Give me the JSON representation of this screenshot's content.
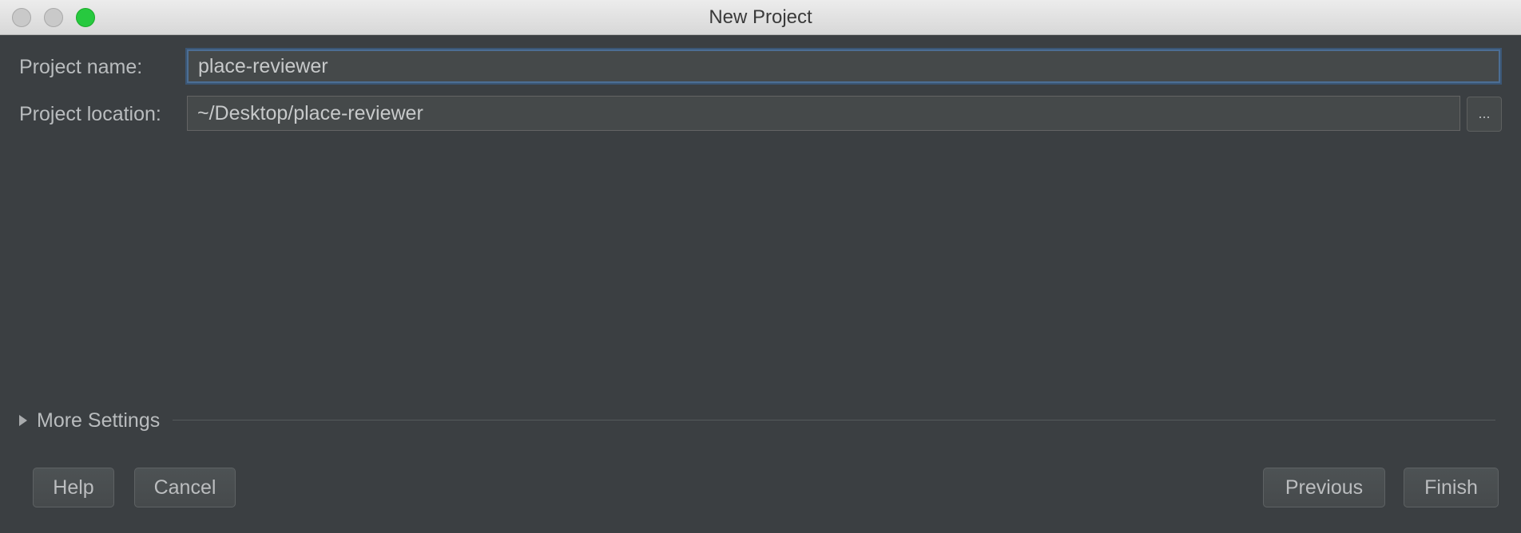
{
  "window": {
    "title": "New Project"
  },
  "form": {
    "project_name_label": "Project name:",
    "project_name_value": "place-reviewer",
    "project_location_label": "Project location:",
    "project_location_value": "~/Desktop/place-reviewer",
    "browse_label": "..."
  },
  "more_settings": {
    "label": "More Settings",
    "icon": "triangle-right-icon"
  },
  "buttons": {
    "help": "Help",
    "cancel": "Cancel",
    "previous": "Previous",
    "finish": "Finish"
  },
  "colors": {
    "background": "#3c3f41",
    "focus_border": "#4c6e94",
    "maximize_green": "#27c93f"
  }
}
